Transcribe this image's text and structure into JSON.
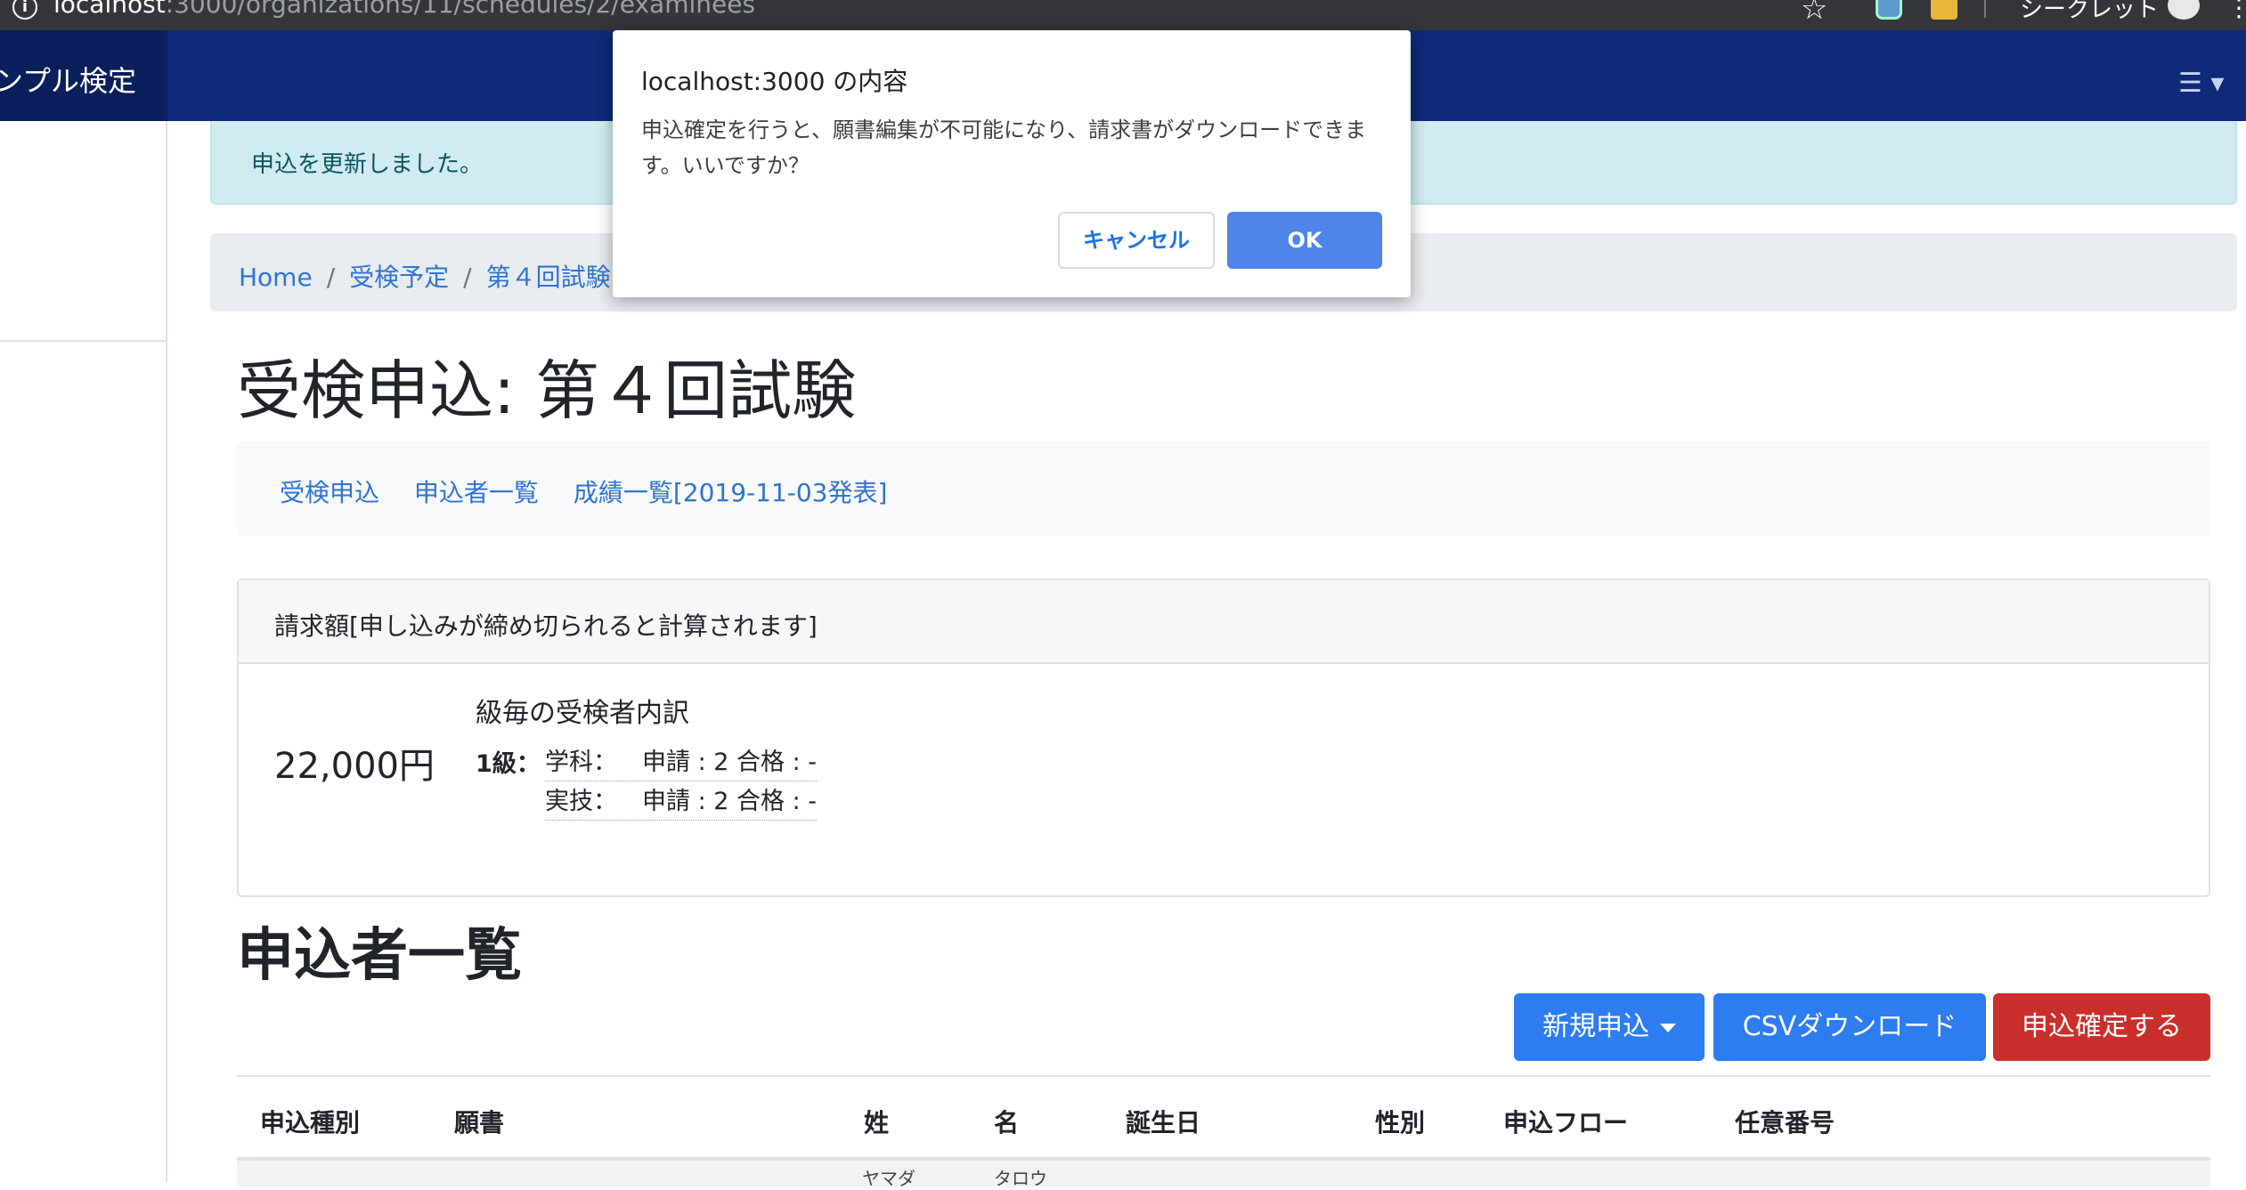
{
  "browser": {
    "url_host": "localhost",
    "url_path": ":3000/organizations/11/schedules/2/examinees",
    "incognito_label": "シークレット"
  },
  "navbar": {
    "brand": "ンプル検定",
    "toggle_icon": "hamburger-icon"
  },
  "alert": {
    "message": "申込を更新しました。"
  },
  "breadcrumb": {
    "items": [
      "Home",
      "受検予定",
      "第４回試験"
    ]
  },
  "page": {
    "title": "受検申込: 第４回試験"
  },
  "subnav": {
    "links": [
      "受検申込",
      "申込者一覧",
      "成績一覧[2019-11-03発表]"
    ]
  },
  "billing": {
    "header": "請求額[申し込みが締め切られると計算されます]",
    "amount": "22,000円",
    "breakdown_title": "級毎の受検者内訳",
    "grade_label": "1級：",
    "rows": [
      {
        "subject": "学科：",
        "apply": "申請 : 2",
        "pass": "合格 : -"
      },
      {
        "subject": "実技：",
        "apply": "申請 : 2",
        "pass": "合格 : -"
      }
    ]
  },
  "applicants": {
    "title": "申込者一覧",
    "buttons": {
      "new": "新規申込",
      "csv": "CSVダウンロード",
      "confirm": "申込確定する"
    },
    "columns": [
      "申込種別",
      "願書",
      "姓",
      "名",
      "誕生日",
      "性別",
      "申込フロー",
      "任意番号"
    ],
    "first_row": {
      "last_kana": "ヤマダ",
      "first_kana": "タロウ"
    }
  },
  "dialog": {
    "title": "localhost:3000 の内容",
    "message": "申込確定を行うと、願書編集が不可能になり、請求書がダウンロードできます。いいですか？",
    "cancel": "キャンセル",
    "ok": "OK"
  },
  "colors": {
    "navbar": "#0e2a78",
    "primary": "#2d7cf0",
    "danger": "#c9302c",
    "alert_bg": "#d1ecf1"
  }
}
